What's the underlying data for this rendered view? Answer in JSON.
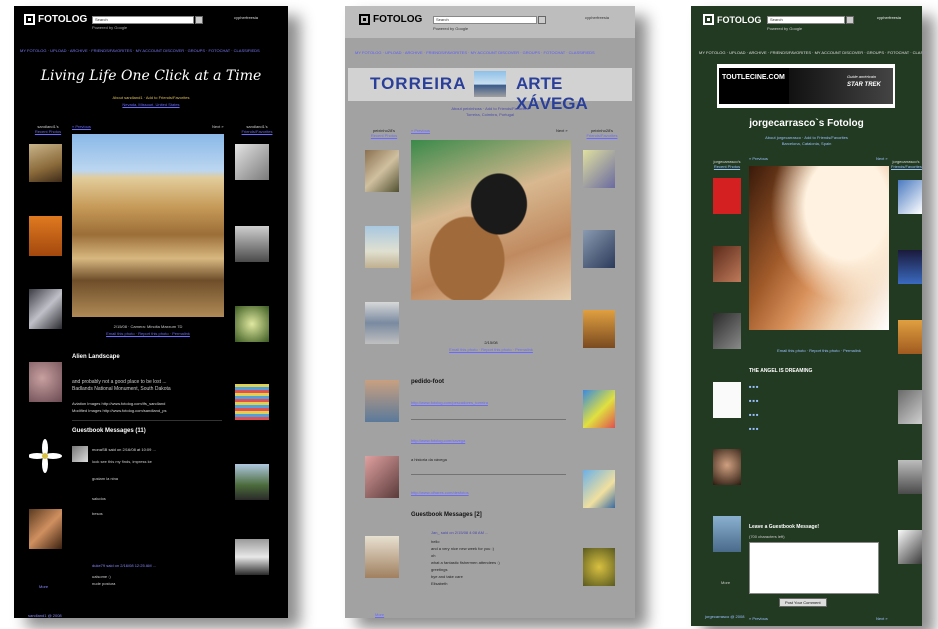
{
  "common": {
    "brand": "FOTOLOG",
    "search_placeholder": "Search",
    "powered_by": "Powered by Google",
    "user": "cypherfreesia",
    "nav": "MY FOTOLOG · UPLOAD · ARCHIVE · FRIENDS/FAVORITES · MY ACCOUNT      DISCOVER · GROUPS · FOTOCHAT · CLASSIFIEDS",
    "previous": "« Previous",
    "next": "Next »",
    "recent_photos": "Recent Photos",
    "friends_favorites": "Friends/Favorites",
    "more": "More"
  },
  "panel1": {
    "title": "Living Life One Click at a Time",
    "subtitle": "About sandland1 · Add to Friends/Favorites",
    "location": "Nevada, Missouri, United States",
    "left_header": "sandland1's",
    "right_header": "sandland1's",
    "post_title": "Alien Landscape",
    "post_body": "and probably not a good place to be lost ...",
    "post_place": "Badlands National Monument, South Dakota",
    "aviation": "Aviation Images http://www.fotolog.com/ifs_sandland",
    "modified": "Modified Images http://www.fotolog.com/sandland_ps",
    "guestbook": "Guestbook Messages (11)",
    "gb_line1": "monaSB said on 2/16/08 at 10:09 ...",
    "gb_line2": "look see this my finds, impress ke",
    "gb_line3": "gustam la nina",
    "gb_line4": "saludos",
    "gb_line5": "besos",
    "gb_line6": "duke79 said on 2/16/08 12:25 AM ...",
    "gb_line7": "ualsome :)",
    "gb_line8": "nude postura",
    "photo_caption": "2/15/08 · Camera: Minolta Maxxum 7D",
    "photo_links": "Email this photo · Report this photo · Permalink",
    "bottom_link": "sandland1 @ 2008"
  },
  "panel2": {
    "banner_left": "TORREIRA",
    "banner_right": "ARTE XÁVEGA",
    "subtitle": "About peixinhoss · Add to Friends/Favorites",
    "location": "Torreira, Coimbra, Portugal",
    "left_header": "peixinho28's",
    "right_header": "peixinho28's",
    "post_title": "pedido-foot",
    "link1": "http://www.fotolog.com/pescadores_torreira",
    "link2": "http://www.fotolog.com/xavega",
    "text1": "a historia da xávega",
    "link3": "http://www.olhares.com/desfotos",
    "guestbook": "Guestbook Messages [2]",
    "gb_line1": "Jan_ said on 2/15/08 4:08 AM ...",
    "gb_line2": "hello",
    "gb_line3": "and a very nice new week for you :)",
    "gb_line4": "oh",
    "gb_line5": "what a fantastic fishermen attendees :)",
    "gb_line6": "greetings",
    "gb_line7": "bye and take care",
    "gb_line8": "Elisabeth",
    "photo_caption": "2/15/08",
    "photo_links": "Email this photo · Report this photo · Permalink"
  },
  "panel3": {
    "ad_brand": "TOUTLECINE.COM",
    "ad_tagline": "Guide américain",
    "ad_title": "STAR TREK",
    "title": "jorgecarrasco`s Fotolog",
    "subtitle": "About jorgecarrasco · Add to Friends/Favorites",
    "location": "Barcelona, Catalonia, Spain",
    "left_header": "jorgecarrasco's",
    "right_header": "jorgecarrasco's",
    "post_title": "THE ANGEL IS DREAMING",
    "guestbook_prompt": "Leave a Guestbook Message!",
    "char_count": "(700 characters left)",
    "post_button": "Post Your Comment",
    "bottom_link": "jorgecarrasco @ 2008"
  }
}
